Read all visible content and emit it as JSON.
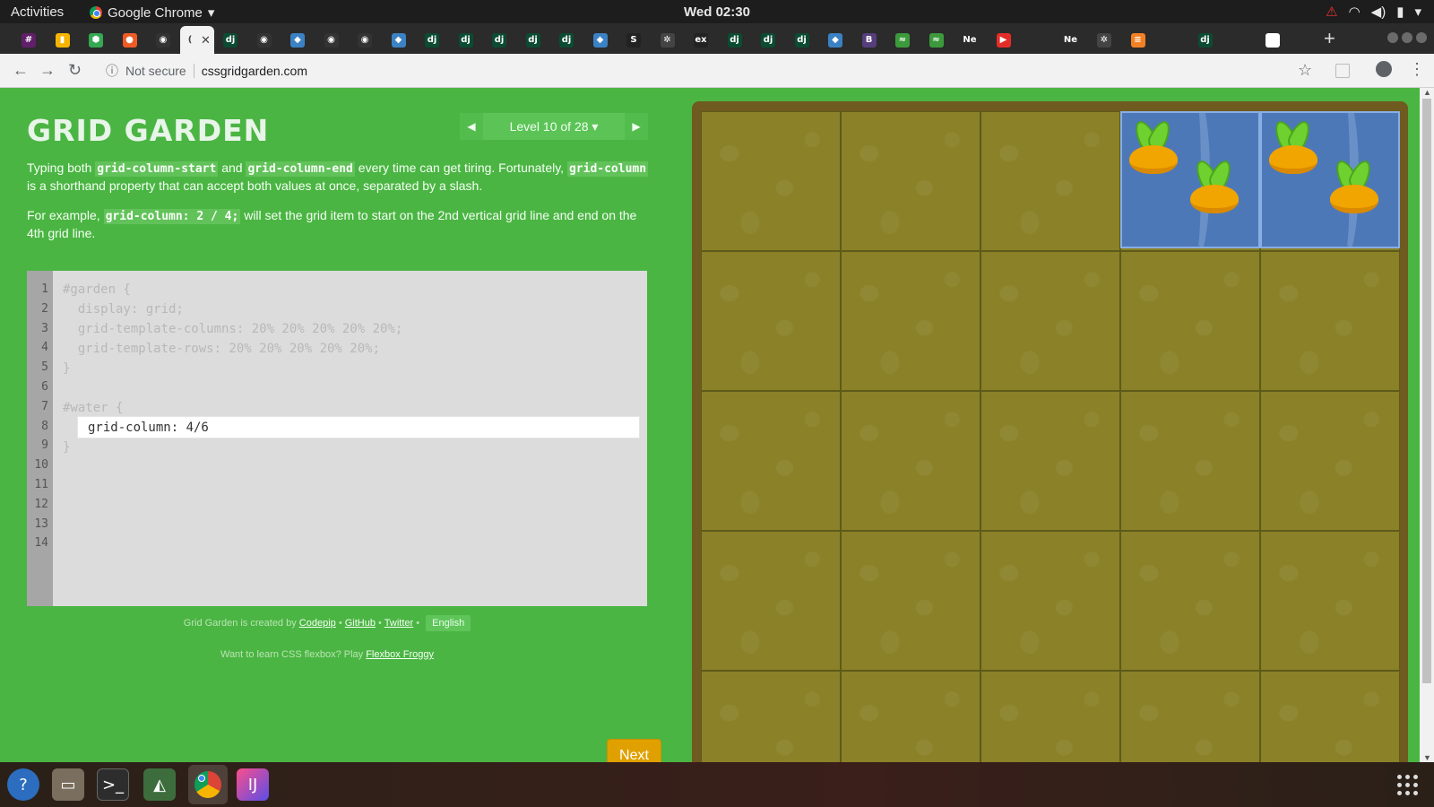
{
  "system": {
    "activities": "Activities",
    "app_name": "Google Chrome",
    "clock": "Wed 02:30"
  },
  "browser": {
    "tabs": [
      {
        "icon": "slack-icon",
        "glyph": "#",
        "color": "#611f69"
      },
      {
        "icon": "bookmark-icon",
        "glyph": "▮",
        "color": "#f4b400"
      },
      {
        "icon": "shield-icon",
        "glyph": "⬢",
        "color": "#34a853"
      },
      {
        "icon": "postman-icon",
        "glyph": "●",
        "color": "#ef5b25"
      },
      {
        "icon": "github-icon",
        "glyph": "◉",
        "color": "#333333"
      },
      {
        "icon": "loading-icon",
        "glyph": "(",
        "color": "#f2f2f2",
        "active": true
      },
      {
        "icon": "django-icon",
        "glyph": "dj",
        "color": "#0c4b33"
      },
      {
        "icon": "github-icon",
        "glyph": "◉",
        "color": "#333333"
      },
      {
        "icon": "codepen-icon",
        "glyph": "◆",
        "color": "#3b82c4"
      },
      {
        "icon": "github-icon",
        "glyph": "◉",
        "color": "#333333"
      },
      {
        "icon": "github-icon",
        "glyph": "◉",
        "color": "#333333"
      },
      {
        "icon": "codepen-icon",
        "glyph": "◆",
        "color": "#3b82c4"
      },
      {
        "icon": "django-icon",
        "glyph": "dj",
        "color": "#0c4b33"
      },
      {
        "icon": "django-icon",
        "glyph": "dj",
        "color": "#0c4b33"
      },
      {
        "icon": "django-icon",
        "glyph": "dj",
        "color": "#0c4b33"
      },
      {
        "icon": "django-icon",
        "glyph": "dj",
        "color": "#0c4b33"
      },
      {
        "icon": "django-icon",
        "glyph": "dj",
        "color": "#0c4b33"
      },
      {
        "icon": "codepen-icon",
        "glyph": "◆",
        "color": "#3b82c4"
      },
      {
        "icon": "s-icon",
        "glyph": "S",
        "color": "#222222"
      },
      {
        "icon": "openai-icon",
        "glyph": "✲",
        "color": "#444444"
      },
      {
        "icon": "ex-icon",
        "glyph": "ex",
        "color": "#222222"
      },
      {
        "icon": "django-icon",
        "glyph": "dj",
        "color": "#0c4b33"
      },
      {
        "icon": "django-icon",
        "glyph": "dj",
        "color": "#0c4b33"
      },
      {
        "icon": "django-icon",
        "glyph": "dj",
        "color": "#0c4b33"
      },
      {
        "icon": "codepen-icon",
        "glyph": "◆",
        "color": "#3b82c4"
      },
      {
        "icon": "bootstrap-icon",
        "glyph": "B",
        "color": "#563d7c"
      },
      {
        "icon": "chart-icon",
        "glyph": "≈",
        "color": "#3c9a3c"
      },
      {
        "icon": "chart-icon",
        "glyph": "≈",
        "color": "#3c9a3c"
      },
      {
        "icon": "new-tab-icon",
        "glyph": "Ne",
        "color": "#2b2b2b"
      },
      {
        "icon": "youtube-icon",
        "glyph": "▶",
        "color": "#e52d27"
      },
      {
        "icon": "blank-page-icon",
        "glyph": "",
        "color": "#2b2b2b"
      },
      {
        "icon": "new-tab-icon",
        "glyph": "Ne",
        "color": "#2b2b2b"
      },
      {
        "icon": "openai-icon",
        "glyph": "✲",
        "color": "#444444"
      },
      {
        "icon": "stackoverflow-icon",
        "glyph": "≡",
        "color": "#f48024"
      },
      {
        "icon": "blank-page-icon",
        "glyph": "",
        "color": "#2b2b2b"
      },
      {
        "icon": "django-icon",
        "glyph": "dj",
        "color": "#0c4b33"
      },
      {
        "icon": "blank-page-icon",
        "glyph": "",
        "color": "#2b2b2b"
      },
      {
        "icon": "google-icon",
        "glyph": "G",
        "color": "#ffffff"
      }
    ],
    "address": {
      "security": "Not secure",
      "url": "cssgridgarden.com"
    }
  },
  "page": {
    "title": "GRID GARDEN",
    "level_label": "Level 10 of 28 ▾",
    "instructions": {
      "p1_a": "Typing both ",
      "p1_code1": "grid-column-start",
      "p1_b": " and ",
      "p1_code2": "grid-column-end",
      "p1_c": " every time can get tiring. Fortunately, ",
      "p1_code3": "grid-column",
      "p1_d": " is a shorthand property that can accept both values at once, separated by a slash.",
      "p2_a": "For example, ",
      "p2_code": "grid-column: 2 / 4;",
      "p2_b": " will set the grid item to start on the 2nd vertical grid line and end on the 4th grid line."
    },
    "editor": {
      "line_numbers": [
        "1",
        "2",
        "3",
        "4",
        "5",
        "6",
        "7",
        "8",
        "9",
        "10",
        "11",
        "12",
        "13",
        "14"
      ],
      "code_lines": {
        "l1": "#garden {",
        "l2": "  display: grid;",
        "l3": "  grid-template-columns: 20% 20% 20% 20% 20%;",
        "l4": "  grid-template-rows: 20% 20% 20% 20% 20%;",
        "l5": "}",
        "l7": "#water {",
        "l9": "}"
      },
      "input_value": "grid-column: 4/6"
    },
    "next_button": "Next",
    "footer": {
      "created_by": "Grid Garden is created by ",
      "codepip": "Codepip",
      "dot1": " • ",
      "github": "GitHub",
      "dot2": " • ",
      "twitter": "Twitter",
      "dot3": " • ",
      "language": "English",
      "flexbox_text": "Want to learn CSS flexbox? Play ",
      "flexbox_link": "Flexbox Froggy"
    }
  },
  "garden": {
    "columns": 5,
    "rows": 5,
    "water_columns": "4/6",
    "water_row": 1,
    "colors": {
      "soil": "#8a8128",
      "water": "#4d78b8",
      "carrot": "#f0a500",
      "leaf": "#6ed12f"
    }
  }
}
